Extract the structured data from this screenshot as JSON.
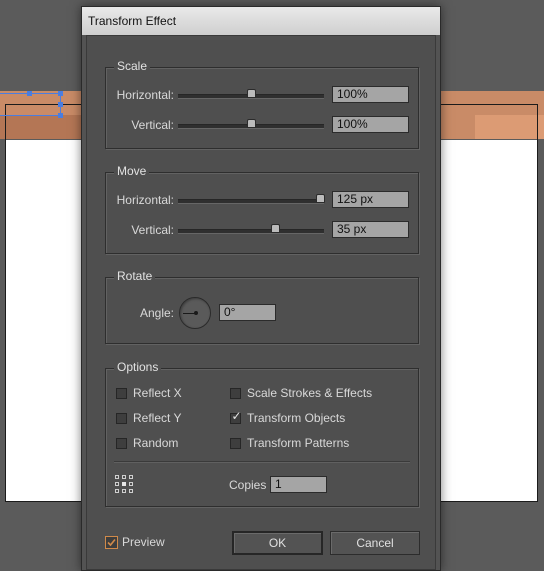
{
  "dialog": {
    "title": "Transform Effect"
  },
  "scale": {
    "legend": "Scale",
    "horizontal_label": "Horizontal:",
    "horizontal_value": "100%",
    "vertical_label": "Vertical:",
    "vertical_value": "100%"
  },
  "move": {
    "legend": "Move",
    "horizontal_label": "Horizontal:",
    "horizontal_value": "125 px",
    "vertical_label": "Vertical:",
    "vertical_value": "35 px"
  },
  "rotate": {
    "legend": "Rotate",
    "angle_label": "Angle:",
    "angle_value": "0°"
  },
  "options": {
    "legend": "Options",
    "reflect_x": "Reflect X",
    "reflect_y": "Reflect Y",
    "random": "Random",
    "scale_strokes": "Scale Strokes & Effects",
    "transform_objects": "Transform Objects",
    "transform_patterns": "Transform Patterns",
    "copies_label": "Copies",
    "copies_value": "1"
  },
  "footer": {
    "preview_label": "Preview",
    "ok_label": "OK",
    "cancel_label": "Cancel"
  },
  "checkmark": "✓",
  "colors": {
    "dialog_bg": "#535353",
    "canvas_orange": "#c98b67",
    "selection_blue": "#4a7de0",
    "preview_check": "#d08a4a"
  }
}
